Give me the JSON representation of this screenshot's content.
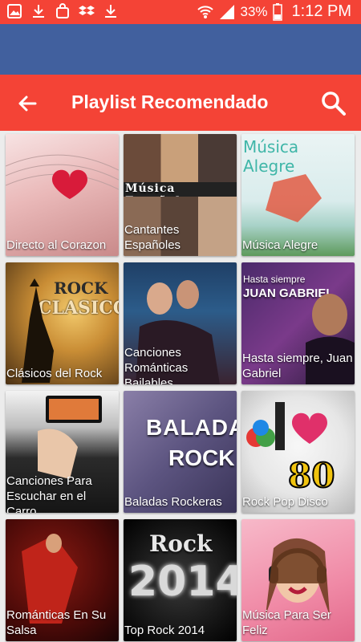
{
  "status_bar": {
    "battery": "33%",
    "time": "1:12 PM",
    "left_icons": [
      "image-icon",
      "download-icon",
      "bag-icon",
      "dropbox-icon",
      "download-icon"
    ],
    "right_icons": [
      "wifi-icon",
      "signal-icon",
      "battery-icon"
    ]
  },
  "toolbar": {
    "title": "Playlist Recomendado",
    "back_icon": "back-arrow-icon",
    "search_icon": "search-icon",
    "color": "#f44336"
  },
  "accent": {
    "toolbar": "#f44336",
    "blue_bar": "#41609e"
  },
  "playlists": [
    {
      "label": "Directo al Corazon",
      "art_text": ""
    },
    {
      "label": "Cantantes Españoles",
      "art_text": "Música Española"
    },
    {
      "label": "Música Alegre",
      "art_text": "Música Alegre"
    },
    {
      "label": "Clásicos del Rock",
      "art_text": "ROCK CLASICO"
    },
    {
      "label": "Canciones Románticas Bailables",
      "art_text": ""
    },
    {
      "label": "Hasta siempre, Juan Gabriel",
      "art_text": "Hasta siempre JUAN GABRIEL"
    },
    {
      "label": "Canciones Para Escuchar en el Carro",
      "art_text": ""
    },
    {
      "label": "Baladas Rockeras",
      "art_text": "BALADAS ROCK"
    },
    {
      "label": "Rock Pop Disco",
      "art_text": "I ♥ THE 80s"
    },
    {
      "label": "Románticas En Su Salsa",
      "art_text": ""
    },
    {
      "label": "Top Rock 2014",
      "art_text": "Rock 2014"
    },
    {
      "label": "Música Para Ser Feliz",
      "art_text": ""
    }
  ]
}
